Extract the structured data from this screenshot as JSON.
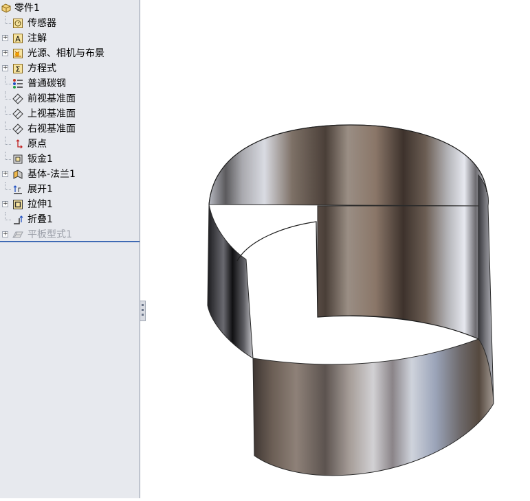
{
  "feature_tree": {
    "root": {
      "label": "零件1",
      "icon": "part-icon"
    },
    "items": [
      {
        "label": "传感器",
        "icon": "sensor-icon",
        "expandable": false
      },
      {
        "label": "注解",
        "icon": "annotations-icon",
        "expandable": true
      },
      {
        "label": "光源、相机与布景",
        "icon": "lights-cameras-scene-icon",
        "expandable": true
      },
      {
        "label": "方程式",
        "icon": "equations-icon",
        "expandable": true
      },
      {
        "label": "普通碳钢",
        "icon": "material-icon",
        "expandable": false
      },
      {
        "label": "前视基准面",
        "icon": "plane-icon",
        "expandable": false
      },
      {
        "label": "上视基准面",
        "icon": "plane-icon",
        "expandable": false
      },
      {
        "label": "右视基准面",
        "icon": "plane-icon",
        "expandable": false
      },
      {
        "label": "原点",
        "icon": "origin-icon",
        "expandable": false
      },
      {
        "label": "钣金1",
        "icon": "sheet-metal-icon",
        "expandable": false
      },
      {
        "label": "基体-法兰1",
        "icon": "base-flange-icon",
        "expandable": true
      },
      {
        "label": "展开1",
        "icon": "unfold-icon",
        "expandable": false
      },
      {
        "label": "拉伸1",
        "icon": "extrude-icon",
        "expandable": true
      },
      {
        "label": "折叠1",
        "icon": "fold-icon",
        "expandable": false
      },
      {
        "label": "平板型式1",
        "icon": "flat-pattern-icon",
        "expandable": true,
        "suppressed": true
      }
    ]
  },
  "colors": {
    "panel_bg": "#e7e9ee",
    "rollback_bar": "#3f6ab4",
    "suppressed_text": "#9b9fa8"
  }
}
